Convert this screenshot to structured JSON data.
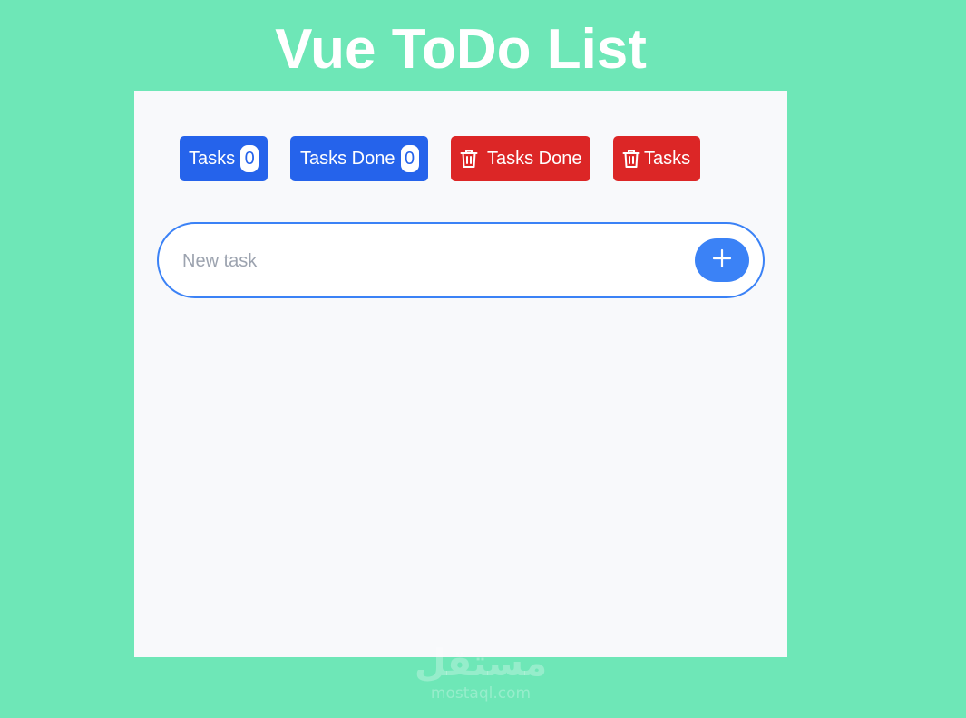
{
  "app": {
    "title": "Vue ToDo List"
  },
  "toolbar": {
    "tasks_label": "Tasks",
    "tasks_count": "0",
    "tasks_done_label": "Tasks Done",
    "tasks_done_count": "0",
    "delete_done_label": "Tasks Done",
    "delete_done_icon": "trash-icon",
    "delete_all_label": "Tasks",
    "delete_all_icon": "trash-icon"
  },
  "new_task": {
    "placeholder": "New task",
    "value": "",
    "add_icon": "plus-icon"
  },
  "watermark": {
    "arabic": "مستقل",
    "latin": "mostaql.com"
  },
  "colors": {
    "background": "#6ee7b7",
    "card": "#f8f9fb",
    "primary": "#2563eb",
    "danger": "#dc2626",
    "accent": "#3b82f6"
  }
}
